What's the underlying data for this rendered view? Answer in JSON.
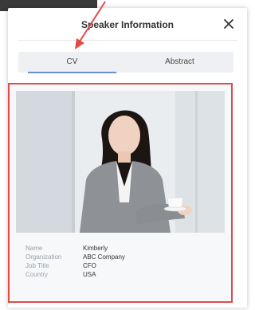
{
  "modal": {
    "title": "Speaker Information"
  },
  "tabs": [
    {
      "label": "CV",
      "active": true
    },
    {
      "label": "Abstract",
      "active": false
    }
  ],
  "speaker": {
    "fields": [
      {
        "label": "Name",
        "value": "Kimberly"
      },
      {
        "label": "Organization",
        "value": "ABC Company"
      },
      {
        "label": "Job Title",
        "value": "CFO"
      },
      {
        "label": "Country",
        "value": "USA"
      }
    ]
  },
  "colors": {
    "highlight": "#e24a4a",
    "tab_underline": "#6c8fd6"
  },
  "icons": {
    "close": "close-icon"
  }
}
